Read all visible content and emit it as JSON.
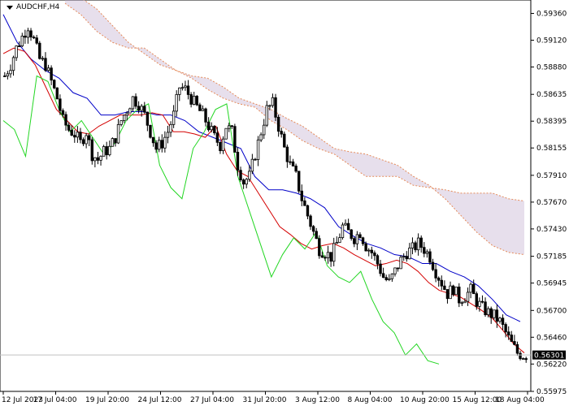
{
  "symbol": "AUDCHF,H4",
  "current_price": "0.56301",
  "colors": {
    "background": "#ffffff",
    "candle": "#000000",
    "tenkan": "#d40000",
    "kijun": "#0000c8",
    "chikou": "#22d622",
    "cloud": "#e58a5a",
    "cloud_fill": "#b9a4c8",
    "price_line": "#c0c0c0",
    "axis": "#000000"
  },
  "chart_data": {
    "type": "candlestick",
    "title": "AUDCHF,H4",
    "indicator": "Ichimoku Kinko Hyo",
    "ylim": [
      0.55975,
      0.5948
    ],
    "y_ticks": [
      "0.59360",
      "0.59120",
      "0.58880",
      "0.58635",
      "0.58395",
      "0.58155",
      "0.57910",
      "0.57670",
      "0.57430",
      "0.57185",
      "0.56945",
      "0.56700",
      "0.56460",
      "0.56220",
      "0.55975"
    ],
    "x_ticks": [
      "12 Jul 2023",
      "17 Jul 04:00",
      "19 Jul 20:00",
      "24 Jul 12:00",
      "27 Jul 04:00",
      "31 Jul 20:00",
      "3 Aug 12:00",
      "8 Aug 04:00",
      "10 Aug 20:00",
      "15 Aug 12:00",
      "18 Aug 04:00"
    ],
    "grid": false,
    "close_series": [
      0.588,
      0.589,
      0.5905,
      0.5915,
      0.5925,
      0.5912,
      0.5895,
      0.589,
      0.5875,
      0.586,
      0.584,
      0.5832,
      0.5828,
      0.582,
      0.583,
      0.581,
      0.5805,
      0.5812,
      0.5815,
      0.5825,
      0.584,
      0.585,
      0.586,
      0.5855,
      0.5845,
      0.583,
      0.5815,
      0.582,
      0.583,
      0.5845,
      0.587,
      0.5868,
      0.586,
      0.5852,
      0.5845,
      0.5835,
      0.5825,
      0.5818,
      0.5835,
      0.583,
      0.58,
      0.5785,
      0.579,
      0.581,
      0.583,
      0.585,
      0.5855,
      0.5835,
      0.5815,
      0.58,
      0.579,
      0.577,
      0.5755,
      0.574,
      0.5725,
      0.5722,
      0.5718,
      0.573,
      0.5745,
      0.574,
      0.5735,
      0.574,
      0.5728,
      0.5722,
      0.5712,
      0.57,
      0.5695,
      0.5705,
      0.5715,
      0.5722,
      0.5725,
      0.573,
      0.5725,
      0.5718,
      0.5705,
      0.5695,
      0.5685,
      0.569,
      0.568,
      0.5683,
      0.5688,
      0.5678,
      0.5672,
      0.5668,
      0.5665,
      0.566,
      0.565,
      0.564,
      0.5632,
      0.563
    ],
    "tenkan_series": [
      0.59,
      0.5905,
      0.5902,
      0.589,
      0.587,
      0.585,
      0.584,
      0.583,
      0.5828,
      0.5835,
      0.584,
      0.5845,
      0.5845,
      0.5845,
      0.5847,
      0.5845,
      0.583,
      0.583,
      0.5828,
      0.5825,
      0.5835,
      0.581,
      0.5795,
      0.579,
      0.5775,
      0.576,
      0.5745,
      0.5738,
      0.573,
      0.5725,
      0.5728,
      0.573,
      0.5726,
      0.572,
      0.5715,
      0.571,
      0.5712,
      0.5715,
      0.5712,
      0.5705,
      0.5695,
      0.5688,
      0.5685,
      0.5682,
      0.5676,
      0.567,
      0.5663,
      0.5652,
      0.564,
      0.5632
    ],
    "kijun_series": [
      0.5935,
      0.591,
      0.5895,
      0.5885,
      0.5878,
      0.5865,
      0.586,
      0.5845,
      0.5845,
      0.5848,
      0.5848,
      0.5845,
      0.5845,
      0.584,
      0.583,
      0.5825,
      0.582,
      0.5815,
      0.579,
      0.5778,
      0.5778,
      0.5775,
      0.577,
      0.5762,
      0.5745,
      0.5737,
      0.573,
      0.5726,
      0.572,
      0.5718,
      0.5712,
      0.5712,
      0.5705,
      0.57,
      0.5692,
      0.568,
      0.5666,
      0.566
    ],
    "chikou_series": [
      0.584,
      0.5832,
      0.5808,
      0.588,
      0.5875,
      0.585,
      0.583,
      0.584,
      0.5825,
      0.581,
      0.582,
      0.584,
      0.585,
      0.5855,
      0.58,
      0.578,
      0.577,
      0.5815,
      0.583,
      0.585,
      0.5855,
      0.579,
      0.576,
      0.573,
      0.57,
      0.572,
      0.5735,
      0.5725,
      0.574,
      0.571,
      0.57,
      0.5695,
      0.5705,
      0.568,
      0.566,
      0.565,
      0.563,
      0.564,
      0.5625,
      0.5622
    ],
    "span_a_series": [
      0.5945,
      0.5935,
      0.592,
      0.591,
      0.5905,
      0.5905,
      0.5895,
      0.5885,
      0.588,
      0.5878,
      0.587,
      0.586,
      0.5855,
      0.585,
      0.5842,
      0.5835,
      0.5825,
      0.5815,
      0.5812,
      0.581,
      0.5805,
      0.58,
      0.579,
      0.5782,
      0.577,
      0.5755,
      0.574,
      0.5728,
      0.5722,
      0.572
    ],
    "span_b_series": [
      0.5955,
      0.595,
      0.594,
      0.5925,
      0.591,
      0.59,
      0.589,
      0.5885,
      0.5878,
      0.5868,
      0.586,
      0.5855,
      0.5852,
      0.584,
      0.5832,
      0.5822,
      0.5815,
      0.581,
      0.58,
      0.579,
      0.579,
      0.579,
      0.5782,
      0.578,
      0.5778,
      0.5775,
      0.5775,
      0.5775,
      0.577,
      0.5768
    ]
  }
}
